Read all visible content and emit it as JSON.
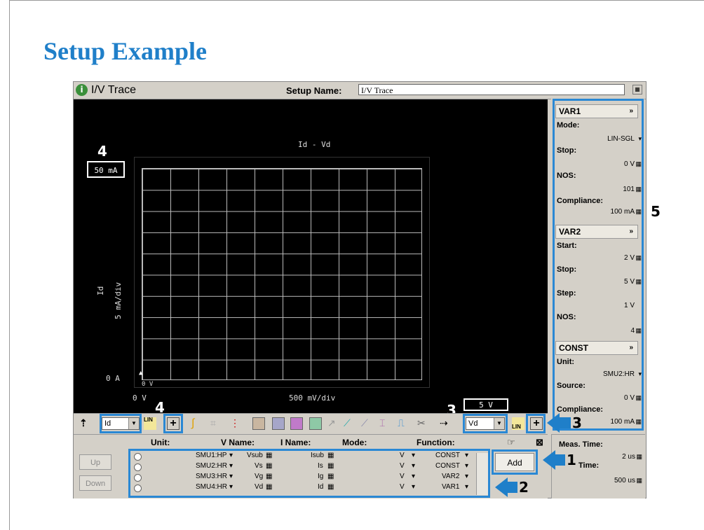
{
  "slide": {
    "title": "Setup Example"
  },
  "app": {
    "icon_glyph": "i",
    "title": "I/V Trace",
    "setup_name_label": "Setup Name:",
    "setup_name_value": "I/V Trace"
  },
  "plot": {
    "title": "Id - Vd",
    "y_max": "50 mA",
    "y_min": "0 A",
    "y_axis_name": "Id",
    "y_scale": "5 mA/div",
    "x_min": "0 V",
    "x_origin_marker": "0 V",
    "x_scale": "500 mV/div",
    "x_axis_name": "Vd",
    "x_max": "5 V"
  },
  "callouts": {
    "n1": "1",
    "n2": "2",
    "n3": "3",
    "n4": "4",
    "n5": "5"
  },
  "toolbar": {
    "y_param": "Id",
    "x_param": "Vd",
    "lin_label": "LIN",
    "plus_glyph": "+"
  },
  "table": {
    "headers": {
      "unit": "Unit:",
      "vname": "V Name:",
      "iname": "I Name:",
      "mode": "Mode:",
      "function": "Function:"
    },
    "rows": [
      {
        "unit": "SMU1:HP",
        "vname": "Vsub",
        "iname": "Isub",
        "mode": "V",
        "function": "CONST"
      },
      {
        "unit": "SMU2:HR",
        "vname": "Vs",
        "iname": "Is",
        "mode": "V",
        "function": "CONST"
      },
      {
        "unit": "SMU3:HR",
        "vname": "Vg",
        "iname": "Ig",
        "mode": "V",
        "function": "VAR2"
      },
      {
        "unit": "SMU4:HR",
        "vname": "Vd",
        "iname": "Id",
        "mode": "V",
        "function": "VAR1"
      }
    ],
    "up_label": "Up",
    "down_label": "Down",
    "add_label": "Add"
  },
  "right_panel": {
    "var1": {
      "title": "VAR1",
      "mode_label": "Mode:",
      "mode_value": "LIN-SGL",
      "stop_label": "Stop:",
      "stop_value": "0 V",
      "nos_label": "NOS:",
      "nos_value": "101",
      "compliance_label": "Compliance:",
      "compliance_value": "100 mA"
    },
    "var2": {
      "title": "VAR2",
      "start_label": "Start:",
      "start_value": "2 V",
      "stop_label": "Stop:",
      "stop_value": "5 V",
      "step_label": "Step:",
      "step_value": "1 V",
      "nos_label": "NOS:",
      "nos_value": "4"
    },
    "const": {
      "title": "CONST",
      "unit_label": "Unit:",
      "unit_value": "SMU2:HR",
      "source_label": "Source:",
      "source_value": "0 V",
      "compliance_label": "Compliance:",
      "compliance_value": "100 mA"
    }
  },
  "meas": {
    "meas_time_label": "Meas. Time:",
    "meas_time_value": "2 us",
    "time_label": "Time:",
    "time_value": "500 us"
  },
  "colors": {
    "accent_blue": "#2a88d4",
    "title_blue": "#1f7fc9",
    "plot_bg": "#000000"
  }
}
